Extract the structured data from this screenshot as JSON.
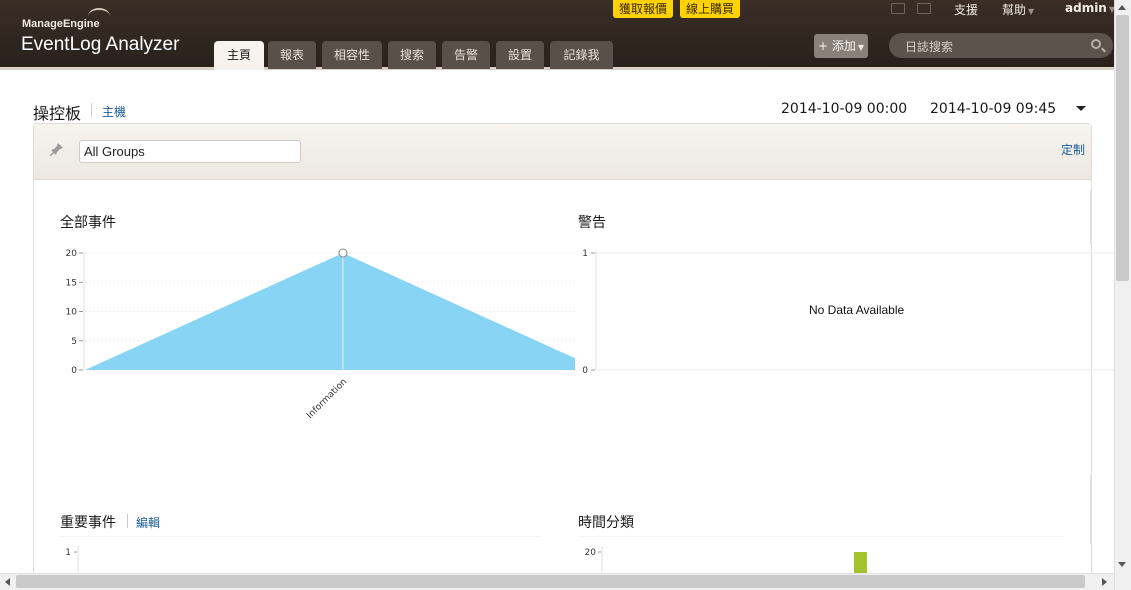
{
  "header": {
    "brand_small": "ManageEngine",
    "brand_main": "EventLog Analyzer",
    "promo_quote": "獲取報價",
    "promo_buy": "線上購買",
    "links": {
      "support": "支援",
      "help": "幫助",
      "user": "admin"
    },
    "tabs": [
      "主頁",
      "報表",
      "相容性",
      "搜索",
      "告警",
      "設置",
      "記錄我"
    ],
    "active_tab": "主頁",
    "add_button": "+ 添加",
    "search_placeholder": "日誌搜索"
  },
  "page": {
    "title": "操控板",
    "host_link": "主機",
    "range_start": "2014-10-09 00:00",
    "range_end": "2014-10-09 09:45"
  },
  "filter": {
    "group_value": "All Groups",
    "customize": "定制"
  },
  "widgets": {
    "all_events": {
      "title": "全部事件"
    },
    "alerts": {
      "title": "警告",
      "no_data": "No Data Available"
    },
    "important_events": {
      "title": "重要事件",
      "edit": "編輯"
    },
    "time_distribution": {
      "title": "時間分類"
    }
  },
  "chart_data": [
    {
      "type": "area",
      "title": "全部事件",
      "categories": [
        "",
        "Information",
        ""
      ],
      "series": [
        {
          "values": [
            0,
            20,
            2
          ]
        }
      ],
      "ylim": [
        0,
        20
      ],
      "yticks": [
        0,
        5,
        10,
        15,
        20
      ],
      "color": "#87d4f5"
    },
    {
      "type": "line",
      "title": "警告",
      "ylim": [
        0,
        1
      ],
      "yticks": [
        0,
        1
      ],
      "series": []
    },
    {
      "type": "bar",
      "title": "重要事件",
      "ylim": [
        0,
        1
      ],
      "yticks": [
        1
      ],
      "series": []
    },
    {
      "type": "bar",
      "title": "時間分類",
      "yticks": [
        20
      ],
      "series": [
        {
          "values": [
            20
          ]
        }
      ],
      "color": "#a4c22c"
    }
  ]
}
